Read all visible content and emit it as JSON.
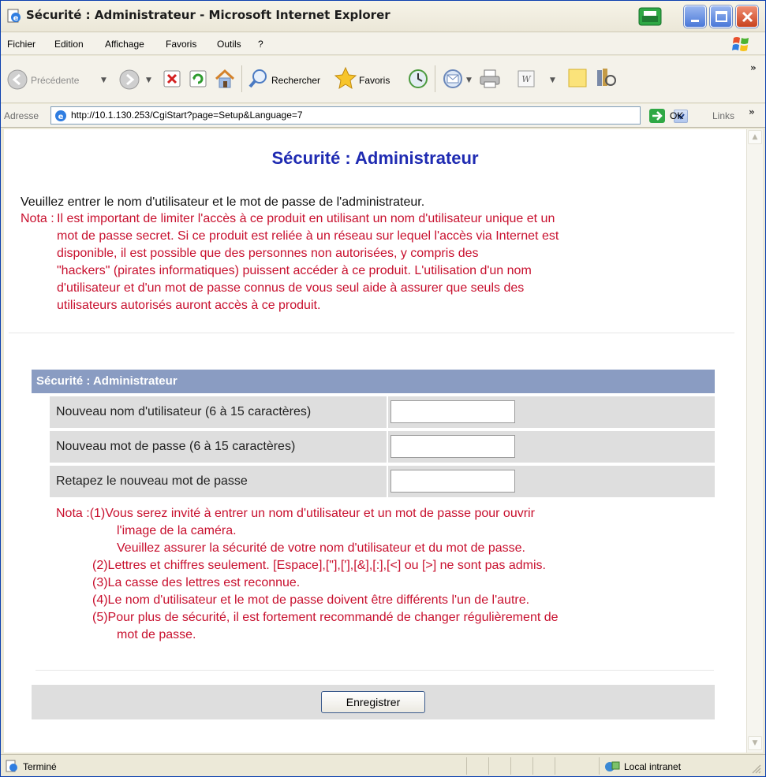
{
  "window": {
    "title": "Sécurité : Administrateur - Microsoft Internet Explorer"
  },
  "menubar": {
    "items": [
      "Fichier",
      "Edition",
      "Affichage",
      "Favoris",
      "Outils",
      "?"
    ]
  },
  "toolbar": {
    "back_label": "Précédente",
    "search_label": "Rechercher",
    "favorites_label": "Favoris"
  },
  "addressbar": {
    "label": "Adresse",
    "url": "http://10.1.130.253/CgiStart?page=Setup&Language=7",
    "go_label": "OK",
    "links_label": "Links"
  },
  "page": {
    "title": "Sécurité : Administrateur",
    "intro": "Veuillez entrer le nom d'utilisateur et le mot de passe de l'administrateur.",
    "note1_prefix": "Nota :",
    "note1_lines": [
      "Il est important de limiter l'accès à ce produit en utilisant un nom d'utilisateur unique et un",
      "mot de passe secret. Si ce produit est reliée à un réseau sur lequel l'accès via Internet est",
      "disponible, il est possible que des personnes non autorisées, y compris des",
      "\"hackers\" (pirates informatiques) puissent accéder à ce produit. L'utilisation d'un nom",
      "d'utilisateur et d'un mot de passe connus de vous seul aide à assurer que seuls des",
      "utilisateurs autorisés auront accès à ce produit."
    ],
    "section_title": "Sécurité : Administrateur",
    "fields": [
      {
        "label": "Nouveau nom d'utilisateur (6 à 15 caractères)",
        "value": ""
      },
      {
        "label": "Nouveau mot de passe (6 à 15 caractères)",
        "value": ""
      },
      {
        "label": "Retapez le nouveau mot de passe",
        "value": ""
      }
    ],
    "note2_lines": [
      "Nota :(1)Vous serez invité à entrer un nom d'utilisateur et un mot de passe pour ouvrir",
      "l'image de la caméra.",
      "Veuillez assurer la sécurité de votre nom d'utilisateur et du mot de passe.",
      "(2)Lettres et chiffres seulement. [Espace],[\"],['],[&],[:],[<] ou [>] ne sont pas admis.",
      "(3)La casse des lettres est reconnue.",
      "(4)Le nom d'utilisateur et le mot de passe doivent être différents l'un de l'autre.",
      "(5)Pour plus de sécurité, il est fortement recommandé de changer régulièrement de",
      "mot de passe."
    ],
    "save_label": "Enregistrer"
  },
  "statusbar": {
    "status": "Terminé",
    "zone": "Local intranet"
  },
  "colors": {
    "title_blue": "#1f2bb2",
    "note_red": "#c8102e",
    "section_header": "#8a9cc2",
    "form_row": "#dedede"
  },
  "icons": [
    "ie-page-icon",
    "printer-icon",
    "minimize-icon",
    "maximize-icon",
    "close-icon",
    "windows-logo-icon",
    "back-icon",
    "forward-icon",
    "stop-icon",
    "refresh-icon",
    "home-icon",
    "search-icon",
    "favorites-star-icon",
    "history-icon",
    "mail-icon",
    "print-icon",
    "edit-icon",
    "notes-icon",
    "research-icon",
    "go-arrow-icon",
    "local-intranet-icon",
    "resize-grip-icon"
  ]
}
